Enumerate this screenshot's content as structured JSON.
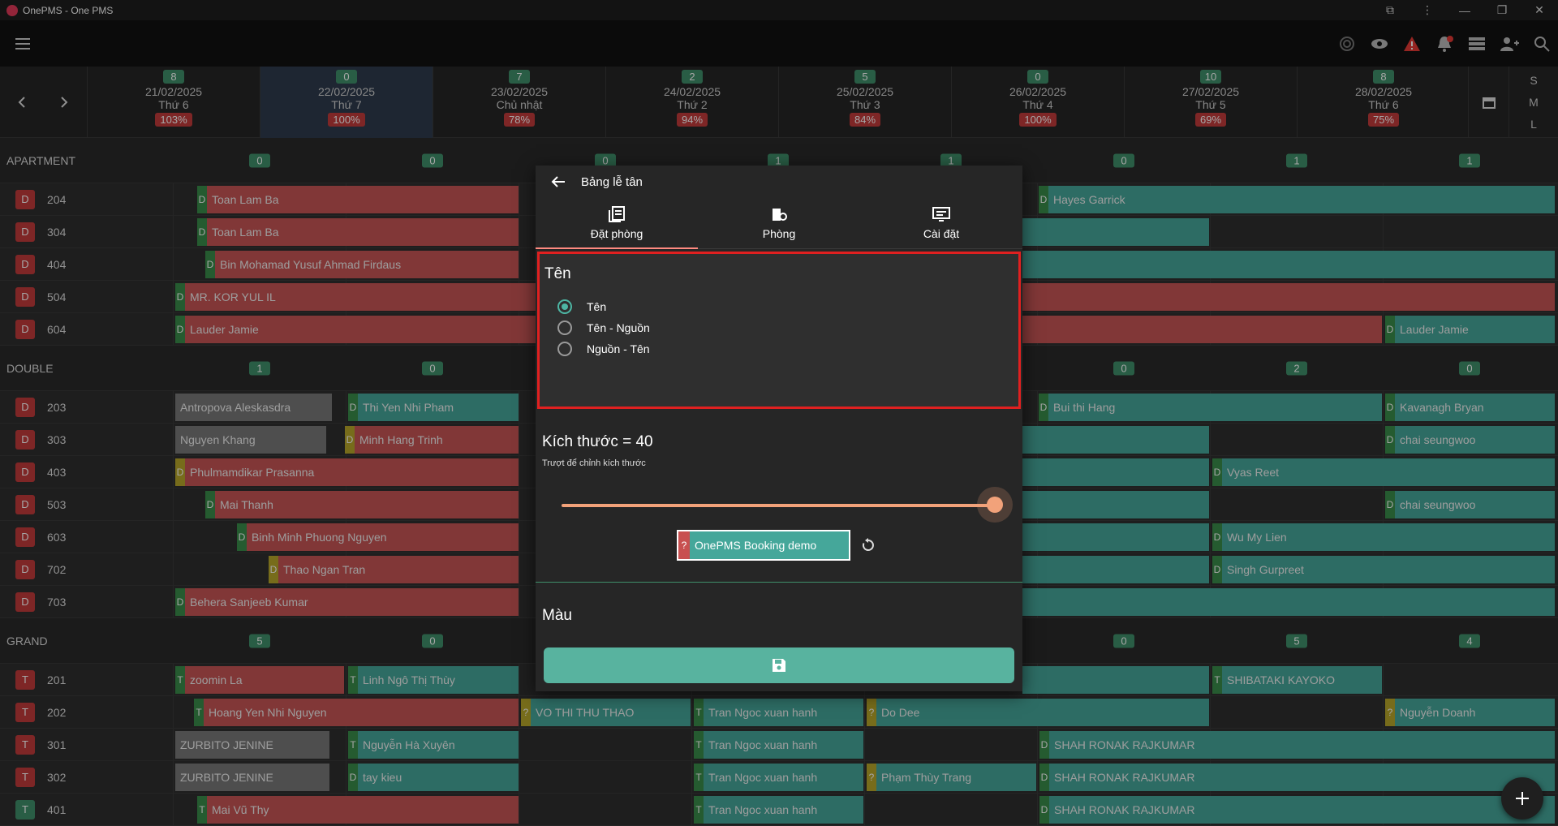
{
  "window": {
    "title": "OnePMS - One PMS"
  },
  "header": {
    "days": [
      {
        "badge": "8",
        "date": "21/02/2025",
        "weekday": "Thứ 6",
        "pct": "103%"
      },
      {
        "badge": "0",
        "date": "22/02/2025",
        "weekday": "Thứ 7",
        "pct": "100%"
      },
      {
        "badge": "7",
        "date": "23/02/2025",
        "weekday": "Chủ nhật",
        "pct": "78%"
      },
      {
        "badge": "2",
        "date": "24/02/2025",
        "weekday": "Thứ 2",
        "pct": "94%"
      },
      {
        "badge": "5",
        "date": "25/02/2025",
        "weekday": "Thứ 3",
        "pct": "84%"
      },
      {
        "badge": "0",
        "date": "26/02/2025",
        "weekday": "Thứ 4",
        "pct": "100%"
      },
      {
        "badge": "10",
        "date": "27/02/2025",
        "weekday": "Thứ 5",
        "pct": "69%"
      },
      {
        "badge": "8",
        "date": "28/02/2025",
        "weekday": "Thứ 6",
        "pct": "75%"
      }
    ],
    "sizes": [
      "S",
      "M",
      "L"
    ]
  },
  "groups": {
    "apartment": {
      "label": "APARTMENT",
      "counts": [
        "0",
        "0",
        "0",
        "1",
        "1",
        "0",
        "1",
        "1"
      ]
    },
    "double": {
      "label": "DOUBLE",
      "counts": [
        "1",
        "0",
        "",
        "",
        "",
        "0",
        "2",
        "0"
      ]
    },
    "grand": {
      "label": "GRAND",
      "counts": [
        "5",
        "0",
        "",
        "",
        "",
        "0",
        "5",
        "4"
      ]
    }
  },
  "rooms": [
    {
      "type": "D",
      "num": "204"
    },
    {
      "type": "D",
      "num": "304"
    },
    {
      "type": "D",
      "num": "404"
    },
    {
      "type": "D",
      "num": "504"
    },
    {
      "type": "D",
      "num": "604"
    },
    {
      "type": "D",
      "num": "203"
    },
    {
      "type": "D",
      "num": "303"
    },
    {
      "type": "D",
      "num": "403"
    },
    {
      "type": "D",
      "num": "503"
    },
    {
      "type": "D",
      "num": "603"
    },
    {
      "type": "D",
      "num": "702"
    },
    {
      "type": "D",
      "num": "703"
    },
    {
      "type": "T",
      "num": "201"
    },
    {
      "type": "T",
      "num": "202"
    },
    {
      "type": "T",
      "num": "301"
    },
    {
      "type": "T",
      "num": "302"
    },
    {
      "type": "T",
      "num": "401"
    }
  ],
  "bookings": {
    "r204a": "Toan Lam Ba",
    "r204b": "Hayes Garrick",
    "r304a": "Toan Lam Ba",
    "r404a": "Bin Mohamad Yusuf Ahmad Firdaus",
    "r504a": "MR. KOR YUL IL",
    "r604a": "Lauder Jamie",
    "r604b": "Lauder Jamie",
    "r203a": "Antropova Aleskasdra",
    "r203b": "Thi Yen Nhi Pham",
    "r203c": "Bui thi Hang",
    "r203d": "Kavanagh Bryan",
    "r303a": "Nguyen Khang",
    "r303b": "Minh Hang Trinh",
    "r303c": "chai seungwoo",
    "r403a": "Phulmamdikar Prasanna",
    "r403b": "Vyas Reet",
    "r503a": "Mai Thanh",
    "r503b": "chai seungwoo",
    "r603a": "Binh Minh Phuong Nguyen",
    "r603b": "Wu My Lien",
    "r702a": "Thao Ngan Tran",
    "r702b": "Singh Gurpreet",
    "r703a": "Behera Sanjeeb Kumar",
    "r201a": "zoomin La",
    "r201b": "Linh Ngô Thị Thùy",
    "r201c": "SHIBATAKI KAYOKO",
    "r202a": "Hoang Yen Nhi Nguyen",
    "r202b": "VO THI THU THAO",
    "r202c": "Tran Ngoc xuan hanh",
    "r202d": "Do Dee",
    "r202e": "Nguyễn Doanh",
    "r301a": "ZURBITO JENINE",
    "r301b": "Nguyễn Hà Xuyên",
    "r301c": "Tran Ngoc xuan hanh",
    "r301d": "SHAH RONAK RAJKUMAR",
    "r302a": "ZURBITO JENINE",
    "r302b": "tay kieu",
    "r302c": "Tran Ngoc xuan hanh",
    "r302d": "Phạm Thùy Trang",
    "r302e": "SHAH RONAK RAJKUMAR",
    "r401a": "Mai Vũ Thy",
    "r401b": "Tran Ngoc xuan hanh",
    "r401c": "SHAH RONAK RAJKUMAR"
  },
  "dialog": {
    "title": "Bảng lễ tân",
    "tabs": [
      "Đặt phòng",
      "Phòng",
      "Cài đặt"
    ],
    "name_section": {
      "title": "Tên",
      "options": [
        "Tên",
        "Tên - Nguồn",
        "Nguồn - Tên"
      ],
      "selected": "Tên"
    },
    "size_section": {
      "title": "Kích thước = 40",
      "hint": "Trượt để chỉnh kích thước",
      "value": 40
    },
    "preview": {
      "tag": "?",
      "label": "OnePMS Booking demo"
    },
    "color_section": {
      "title": "Màu"
    }
  },
  "colors": {
    "accent": "#58b39f",
    "booking_red": "#c65555",
    "booking_teal": "#45a79a",
    "highlight": "#e02020"
  }
}
